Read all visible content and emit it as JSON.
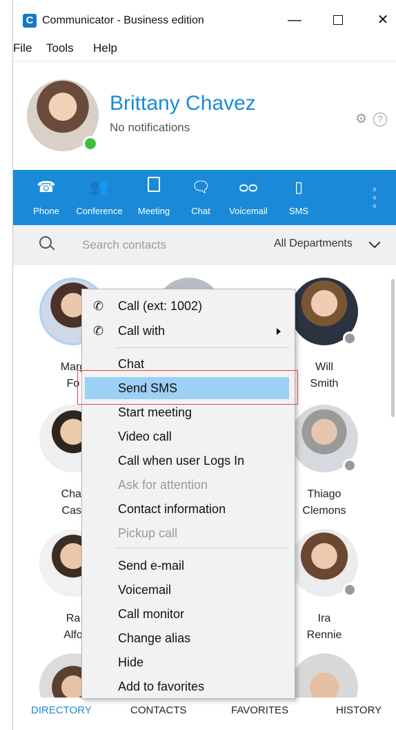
{
  "window": {
    "title": "Communicator - Business edition"
  },
  "menubar": [
    "File",
    "Tools",
    "Help"
  ],
  "profile": {
    "name": "Brittany Chavez",
    "status": "No notifications"
  },
  "toolbar": [
    {
      "label": "Phone",
      "icon": "phone-icon"
    },
    {
      "label": "Conference",
      "icon": "conference-icon"
    },
    {
      "label": "Meeting",
      "icon": "meeting-icon"
    },
    {
      "label": "Chat",
      "icon": "chat-icon"
    },
    {
      "label": "Voicemail",
      "icon": "voicemail-icon"
    },
    {
      "label": "SMS",
      "icon": "sms-icon"
    }
  ],
  "search": {
    "placeholder": "Search contacts",
    "department": "All Departments"
  },
  "contacts": [
    {
      "line1": "Marg",
      "line2": "Fo"
    },
    {
      "line1": "Will",
      "line2": "Smith"
    },
    {
      "line1": "Char",
      "line2": "Cast"
    },
    {
      "line1": "Thiago",
      "line2": "Clemons"
    },
    {
      "line1": "Ra",
      "line2": "Alfo"
    },
    {
      "line1": "Ira",
      "line2": "Rennie"
    }
  ],
  "context_menu": {
    "items": [
      {
        "label": "Call (ext: 1002)",
        "icon": "handset-icon"
      },
      {
        "label": "Call with",
        "icon": "handset-icon",
        "submenu": true
      },
      {
        "label": "Chat"
      },
      {
        "label": "Send SMS",
        "highlight": true
      },
      {
        "label": "Start meeting"
      },
      {
        "label": "Video call"
      },
      {
        "label": "Call when user Logs In"
      },
      {
        "label": "Ask for attention",
        "disabled": true
      },
      {
        "label": "Contact information"
      },
      {
        "label": "Pickup call",
        "disabled": true
      },
      {
        "label": "Send e-mail"
      },
      {
        "label": "Voicemail"
      },
      {
        "label": "Call monitor"
      },
      {
        "label": "Change alias"
      },
      {
        "label": "Hide"
      },
      {
        "label": "Add to favorites"
      }
    ]
  },
  "tabs": [
    {
      "label": "DIRECTORY",
      "active": true
    },
    {
      "label": "CONTACTS"
    },
    {
      "label": "FAVORITES"
    },
    {
      "label": "HISTORY"
    }
  ],
  "colors": {
    "accent": "#1a8ad8",
    "online": "#3fbf3f",
    "offline": "#9a9a9a",
    "highlight": "#9dd0f5",
    "callout": "#e0454a"
  }
}
